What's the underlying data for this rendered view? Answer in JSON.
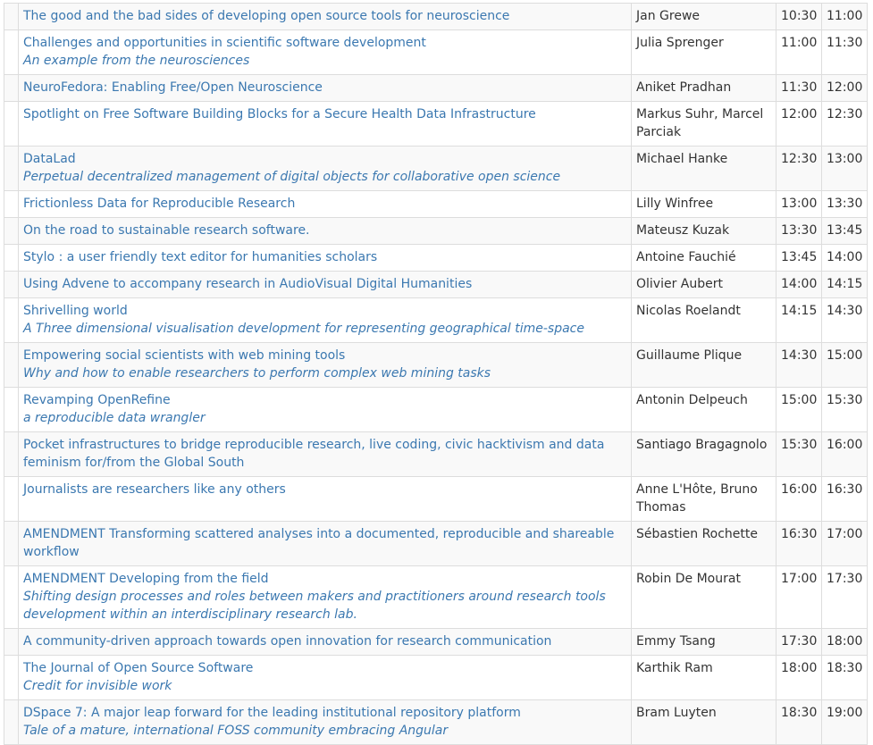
{
  "schedule": {
    "rows": [
      {
        "color": "#e2e6d3",
        "title": "The good and the bad sides of developing open source tools for neuroscience",
        "subtitle": "",
        "speaker": "Jan Grewe",
        "start": "10:30",
        "end": "11:00"
      },
      {
        "color": "#ef7a34",
        "title": "Challenges and opportunities in scientific software development",
        "subtitle": "An example from the neurosciences",
        "speaker": "Julia Sprenger",
        "start": "11:00",
        "end": "11:30"
      },
      {
        "color": "#f76a0c",
        "title": "NeuroFedora: Enabling Free/Open Neuroscience",
        "subtitle": "",
        "speaker": "Aniket Pradhan",
        "start": "11:30",
        "end": "12:00"
      },
      {
        "color": "#e9773f",
        "title": "Spotlight on Free Software Building Blocks for a Secure Health Data Infrastructure",
        "subtitle": "",
        "speaker": "Markus Suhr, Marcel Parciak",
        "start": "12:00",
        "end": "12:30"
      },
      {
        "color": "#e9a04f",
        "title": "DataLad",
        "subtitle": "Perpetual decentralized management of digital objects for collaborative open science",
        "speaker": "Michael Hanke",
        "start": "12:30",
        "end": "13:00"
      },
      {
        "color": "#f9c57e",
        "title": "Frictionless Data for Reproducible Research",
        "subtitle": "",
        "speaker": "Lilly Winfree",
        "start": "13:00",
        "end": "13:30"
      },
      {
        "color": "#c6d9b9",
        "title": "On the road to sustainable research software.",
        "subtitle": "",
        "speaker": "Mateusz Kuzak",
        "start": "13:30",
        "end": "13:45"
      },
      {
        "color": "#a08a6b",
        "title": "Stylo : a user friendly text editor for humanities scholars",
        "subtitle": "",
        "speaker": "Antoine Fauchié",
        "start": "13:45",
        "end": "14:00"
      },
      {
        "color": "#5ccde0",
        "title": "Using Advene to accompany research in AudioVisual Digital Humanities",
        "subtitle": "",
        "speaker": "Olivier Aubert",
        "start": "14:00",
        "end": "14:15"
      },
      {
        "color": "#a8d9d8",
        "title": "Shrivelling world",
        "subtitle": "A Three dimensional visualisation development for representing geographical time-space",
        "speaker": "Nicolas Roelandt",
        "start": "14:15",
        "end": "14:30"
      },
      {
        "color": "#e2e6d3",
        "title": "Empowering social scientists with web mining tools",
        "subtitle": "Why and how to enable researchers to perform complex web mining tasks",
        "speaker": "Guillaume Plique",
        "start": "14:30",
        "end": "15:00"
      },
      {
        "color": "#ef7a34",
        "title": "Revamping OpenRefine",
        "subtitle": "a reproducible data wrangler",
        "speaker": "Antonin Delpeuch",
        "start": "15:00",
        "end": "15:30"
      },
      {
        "color": "#f76a0c",
        "title": "Pocket infrastructures to bridge reproducible research, live coding, civic hacktivism and data feminism for/from the Global South",
        "subtitle": "",
        "speaker": "Santiago Bragagnolo",
        "start": "15:30",
        "end": "16:00"
      },
      {
        "color": "#e9773f",
        "title": "Journalists are researchers like any others",
        "subtitle": "",
        "speaker": "Anne L'Hôte, Bruno Thomas",
        "start": "16:00",
        "end": "16:30"
      },
      {
        "color": "#e9a04f",
        "title": "AMENDMENT Transforming scattered analyses into a documented, reproducible and shareable workflow",
        "subtitle": "",
        "speaker": "Sébastien Rochette",
        "start": "16:30",
        "end": "17:00"
      },
      {
        "color": "#f9c57e",
        "title": "AMENDMENT Developing from the field",
        "subtitle": "Shifting design processes and roles between makers and practitioners around research tools development within an interdisciplinary research lab.",
        "speaker": "Robin De Mourat",
        "start": "17:00",
        "end": "17:30"
      },
      {
        "color": "#c6d9b9",
        "title": "A community-driven approach towards open innovation for research communication",
        "subtitle": "",
        "speaker": "Emmy Tsang",
        "start": "17:30",
        "end": "18:00"
      },
      {
        "color": "#a08a6b",
        "title": "The Journal of Open Source Software",
        "subtitle": "Credit for invisible work",
        "speaker": "Karthik Ram",
        "start": "18:00",
        "end": "18:30"
      },
      {
        "color": "#5ccde0",
        "title": "DSpace 7: A major leap forward for the leading institutional repository platform",
        "subtitle": "Tale of a mature, international FOSS community embracing Angular",
        "speaker": "Bram Luyten",
        "start": "18:30",
        "end": "19:00"
      }
    ]
  }
}
